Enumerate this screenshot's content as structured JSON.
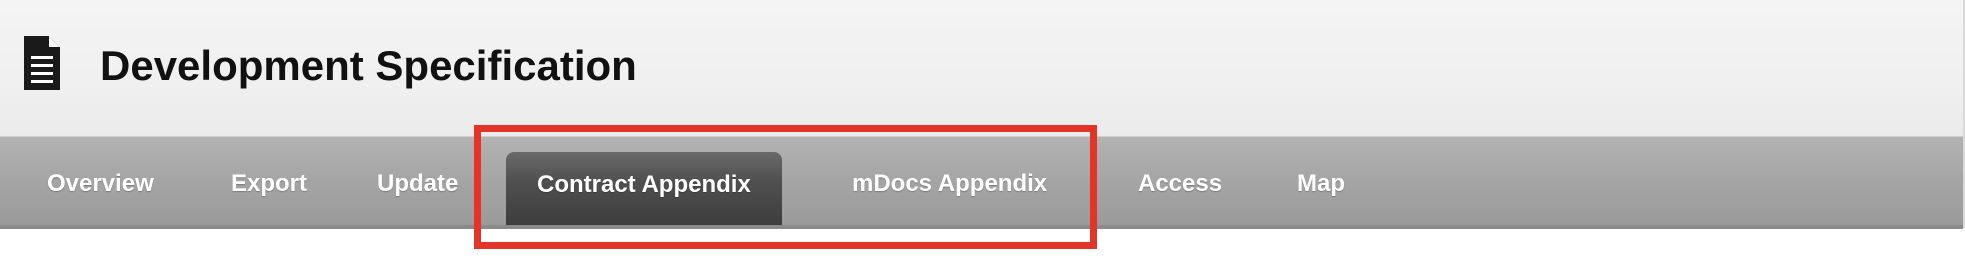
{
  "header": {
    "title": "Development Specification",
    "icon": "document-icon"
  },
  "nav": {
    "tabs": [
      {
        "label": "Overview",
        "active": false
      },
      {
        "label": "Export",
        "active": false
      },
      {
        "label": "Update",
        "active": false
      },
      {
        "label": "Contract Appendix",
        "active": true
      },
      {
        "label": "mDocs Appendix",
        "active": false
      },
      {
        "label": "Access",
        "active": false
      },
      {
        "label": "Map",
        "active": false
      }
    ]
  },
  "colors": {
    "highlight": "#e3342a",
    "active_tab": "#4a4a4a",
    "nav_bar": "#a8a8a8"
  }
}
